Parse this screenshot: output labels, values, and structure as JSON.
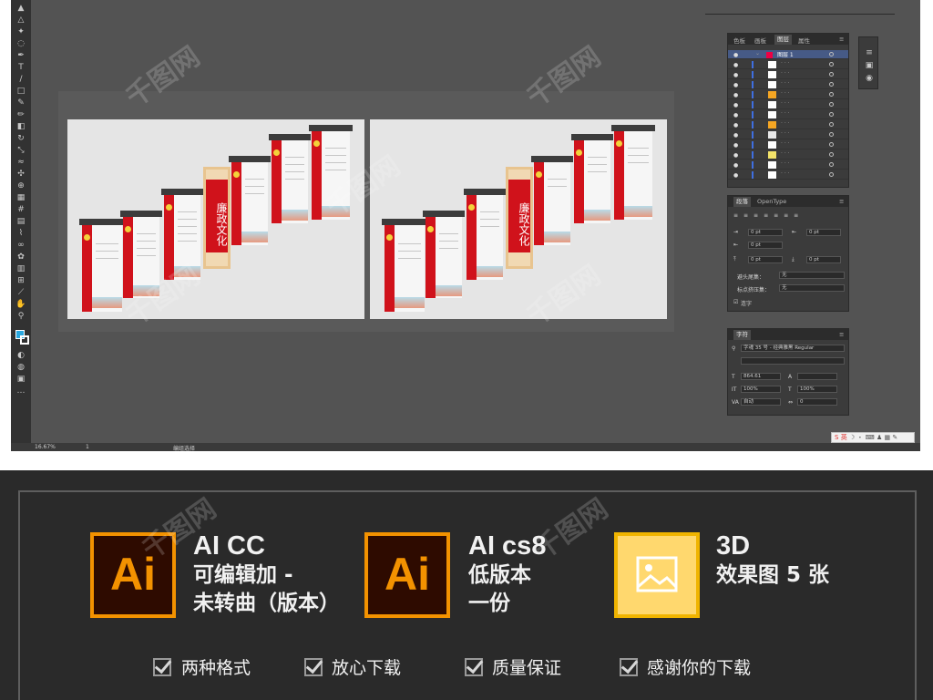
{
  "app": {
    "zoom": "16.67%",
    "artboard_num": "1",
    "status_text": "编组选择",
    "panels": {
      "layers_tabs": [
        "色板",
        "画板",
        "图层",
        "属性"
      ],
      "layer_name": "图层 1",
      "paragraph_tabs": [
        "段落",
        "OpenType"
      ],
      "indent_values": [
        "0 pt",
        "0 pt",
        "0 pt",
        "0 pt",
        "0 pt"
      ],
      "avoid_head_label": "避头尾集：",
      "avoid_head_value": "无",
      "punct_label": "标点挤压集：",
      "punct_value": "无",
      "hyphen_label": "连字",
      "character_tab": "字符",
      "font_name": "字魂 35 号 - 经典雅黑 Regular",
      "font_size": "864.61",
      "scale_v": "100%",
      "scale_h": "100%",
      "leading": "自动",
      "tracking": "0",
      "ime_text": "英"
    },
    "artwork": {
      "center_title": "廉政文化",
      "panel_titles": [
        "廉洁自律准则",
        "廉洁自律（十不准）",
        "中央八项规定",
        "中央六项禁令",
        "党员廉洁自律",
        "党风廉政建设"
      ]
    }
  },
  "info": {
    "items": [
      {
        "title": "AI CC",
        "line2": "可编辑加 -",
        "line3": "未转曲（版本）"
      },
      {
        "title": "AI cs8",
        "line2": "低版本",
        "line3": "一份"
      },
      {
        "title": "3D",
        "line2": "效果图 5 张",
        "line3": ""
      }
    ],
    "features": [
      "两种格式",
      "放心下载",
      "质量保证",
      "感谢你的下载"
    ]
  },
  "colors": {
    "ai_orange": "#f39200",
    "ai_bg": "#2e0b00",
    "image_yellow": "#ffd86e",
    "party_red": "#d0121b"
  }
}
